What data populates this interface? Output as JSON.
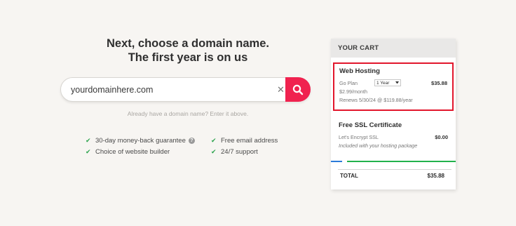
{
  "headline": {
    "line1": "Next, choose a domain name.",
    "line2": "The first year is on us"
  },
  "search": {
    "value": "yourdomainhere.com",
    "placeholder": "yourdomainhere.com",
    "clear_icon": "✕",
    "button_icon": "search-icon"
  },
  "hint": "Already have a domain name? Enter it above.",
  "features": {
    "col1": [
      "30-day money-back guarantee",
      "Choice of website builder"
    ],
    "col2": [
      "Free email address",
      "24/7 support"
    ],
    "check_glyph": "✔",
    "help_glyph": "?"
  },
  "cart": {
    "header": "YOUR CART",
    "hosting": {
      "title": "Web Hosting",
      "plan": "Go Plan",
      "term": "1 Year",
      "price": "$35.88",
      "monthly": "$2.99/month",
      "renews": "Renews 5/30/24 @ $119.88/year"
    },
    "ssl": {
      "title": "Free SSL Certificate",
      "name": "Let's Encrypt SSL",
      "price": "$0.00",
      "note": "Included with your hosting package"
    },
    "total_label": "TOTAL",
    "total_value": "$35.88"
  },
  "colors": {
    "accent": "#f0224f",
    "highlight_border": "#e2162c",
    "check": "#2ea44f",
    "progress_green": "#22b24c",
    "progress_blue": "#2b7bd8"
  }
}
